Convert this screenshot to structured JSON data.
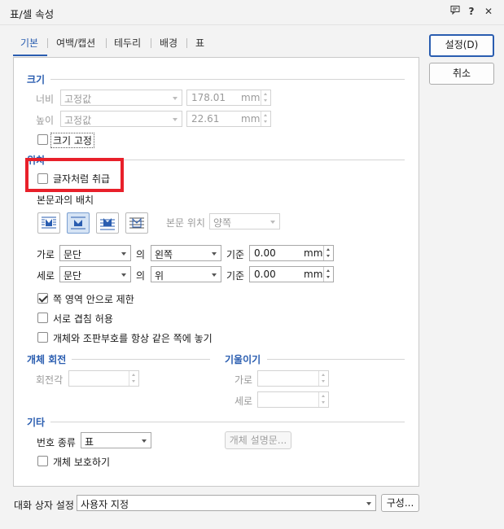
{
  "window": {
    "title": "표/셀 속성"
  },
  "titlebar_icons": {
    "chat": "chat-icon",
    "help": "?",
    "close": "✕"
  },
  "tabs": [
    {
      "label": "기본",
      "active": true
    },
    {
      "label": "여백/캡션"
    },
    {
      "label": "테두리"
    },
    {
      "label": "배경"
    },
    {
      "label": "표"
    }
  ],
  "size": {
    "title": "크기",
    "width_label": "너비",
    "width_mode": "고정값",
    "width_value": "178.01",
    "width_unit": "mm",
    "height_label": "높이",
    "height_mode": "고정값",
    "height_value": "22.61",
    "height_unit": "mm",
    "fix_size_label": "크기 고정"
  },
  "position": {
    "title": "위치",
    "treat_as_char_label": "글자처럼 취급",
    "text_arrange_label": "본문과의 배치",
    "body_pos_label": "본문 위치",
    "body_pos_value": "양쪽",
    "horiz_label": "가로",
    "horiz_rel": "문단",
    "of_label": "의",
    "horiz_align": "왼쪽",
    "base_label": "기준",
    "horiz_value": "0.00",
    "unit": "mm",
    "vert_label": "세로",
    "vert_rel": "문단",
    "vert_align": "위",
    "vert_value": "0.00",
    "limit_label": "쪽 영역 안으로 제한",
    "overlap_label": "서로 겹침 허용",
    "same_page_label": "개체와 조판부호를 항상 같은 쪽에 놓기"
  },
  "rotation": {
    "title": "개체 회전",
    "angle_label": "회전각"
  },
  "skew": {
    "title": "기울이기",
    "horiz_label": "가로",
    "vert_label": "세로"
  },
  "etc": {
    "title": "기타",
    "number_type_label": "번호 종류",
    "number_type_value": "표",
    "description_button": "개체 설명문...",
    "protect_label": "개체 보호하기"
  },
  "buttons": {
    "ok": "설정(D)",
    "cancel": "취소"
  },
  "footer": {
    "preset_label": "대화 상자 설정",
    "preset_value": "사용자 지정",
    "config_button": "구성..."
  },
  "colors": {
    "accent": "#2a5db0",
    "highlight": "#e8202a"
  }
}
